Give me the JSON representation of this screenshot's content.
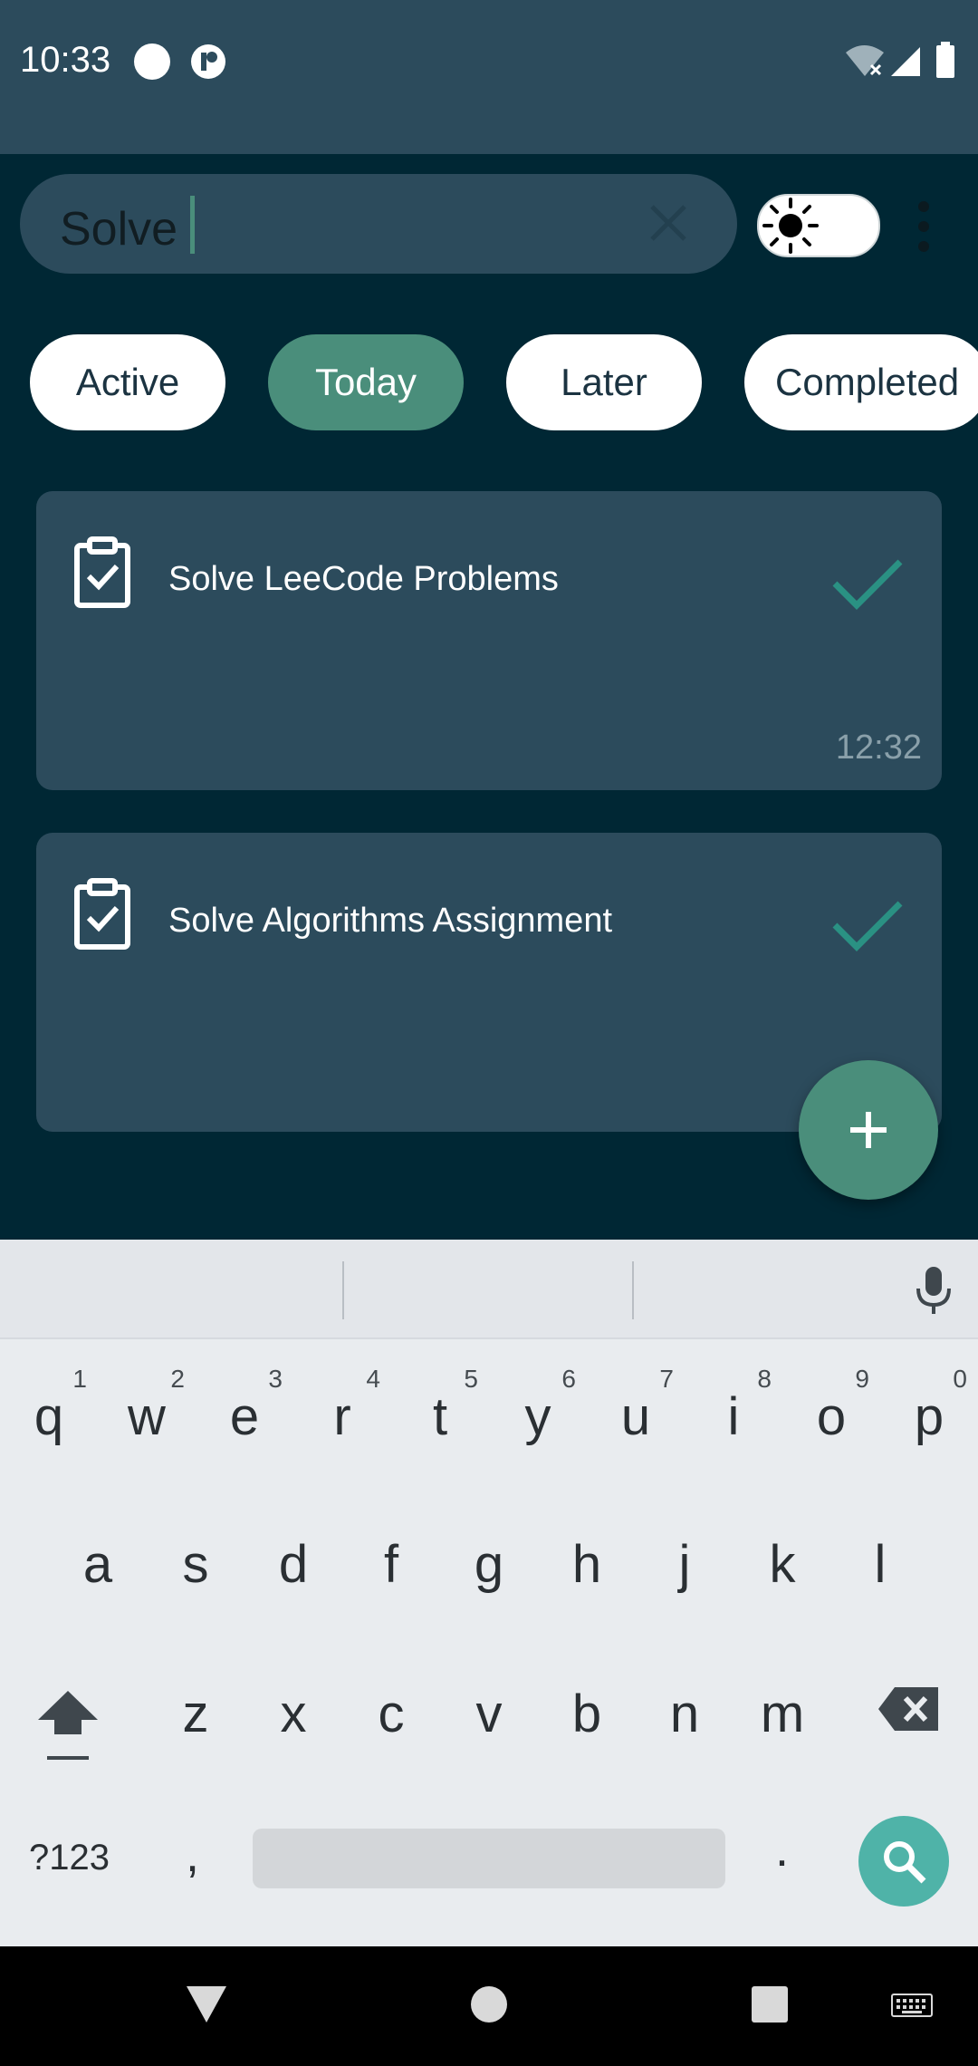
{
  "status_bar": {
    "time": "10:33",
    "icons": [
      "circle-notification-icon",
      "app-notification-icon",
      "wifi-icon",
      "signal-icon",
      "battery-icon"
    ]
  },
  "search": {
    "value": "Solve",
    "clear_icon": "close-icon"
  },
  "theme_toggle": {
    "icon": "sun-icon",
    "state": "light"
  },
  "menu_icon": "more-vert-icon",
  "filters": [
    {
      "label": "Active",
      "selected": false
    },
    {
      "label": "Today",
      "selected": true
    },
    {
      "label": "Later",
      "selected": false
    },
    {
      "label": "Completed",
      "selected": false
    }
  ],
  "tasks": [
    {
      "title": "Solve LeeCode Problems",
      "time": "12:32",
      "icon": "clipboard-check-icon",
      "done_icon": "check-icon"
    },
    {
      "title": "Solve Algorithms Assignment",
      "time": "",
      "icon": "clipboard-check-icon",
      "done_icon": "check-icon"
    }
  ],
  "fab": {
    "icon": "plus-icon"
  },
  "keyboard": {
    "row1": [
      "q",
      "w",
      "e",
      "r",
      "t",
      "y",
      "u",
      "i",
      "o",
      "p"
    ],
    "row1_hints": [
      "1",
      "2",
      "3",
      "4",
      "5",
      "6",
      "7",
      "8",
      "9",
      "0"
    ],
    "row2": [
      "a",
      "s",
      "d",
      "f",
      "g",
      "h",
      "j",
      "k",
      "l"
    ],
    "row3": [
      "z",
      "x",
      "c",
      "v",
      "b",
      "n",
      "m"
    ],
    "num_label": "?123",
    "comma": ",",
    "period": ".",
    "action_icon": "search-icon"
  },
  "colors": {
    "background": "#002734",
    "surface": "#2c4b5c",
    "accent": "#4a8e7b",
    "keyboard_action": "#4fb3a8"
  }
}
